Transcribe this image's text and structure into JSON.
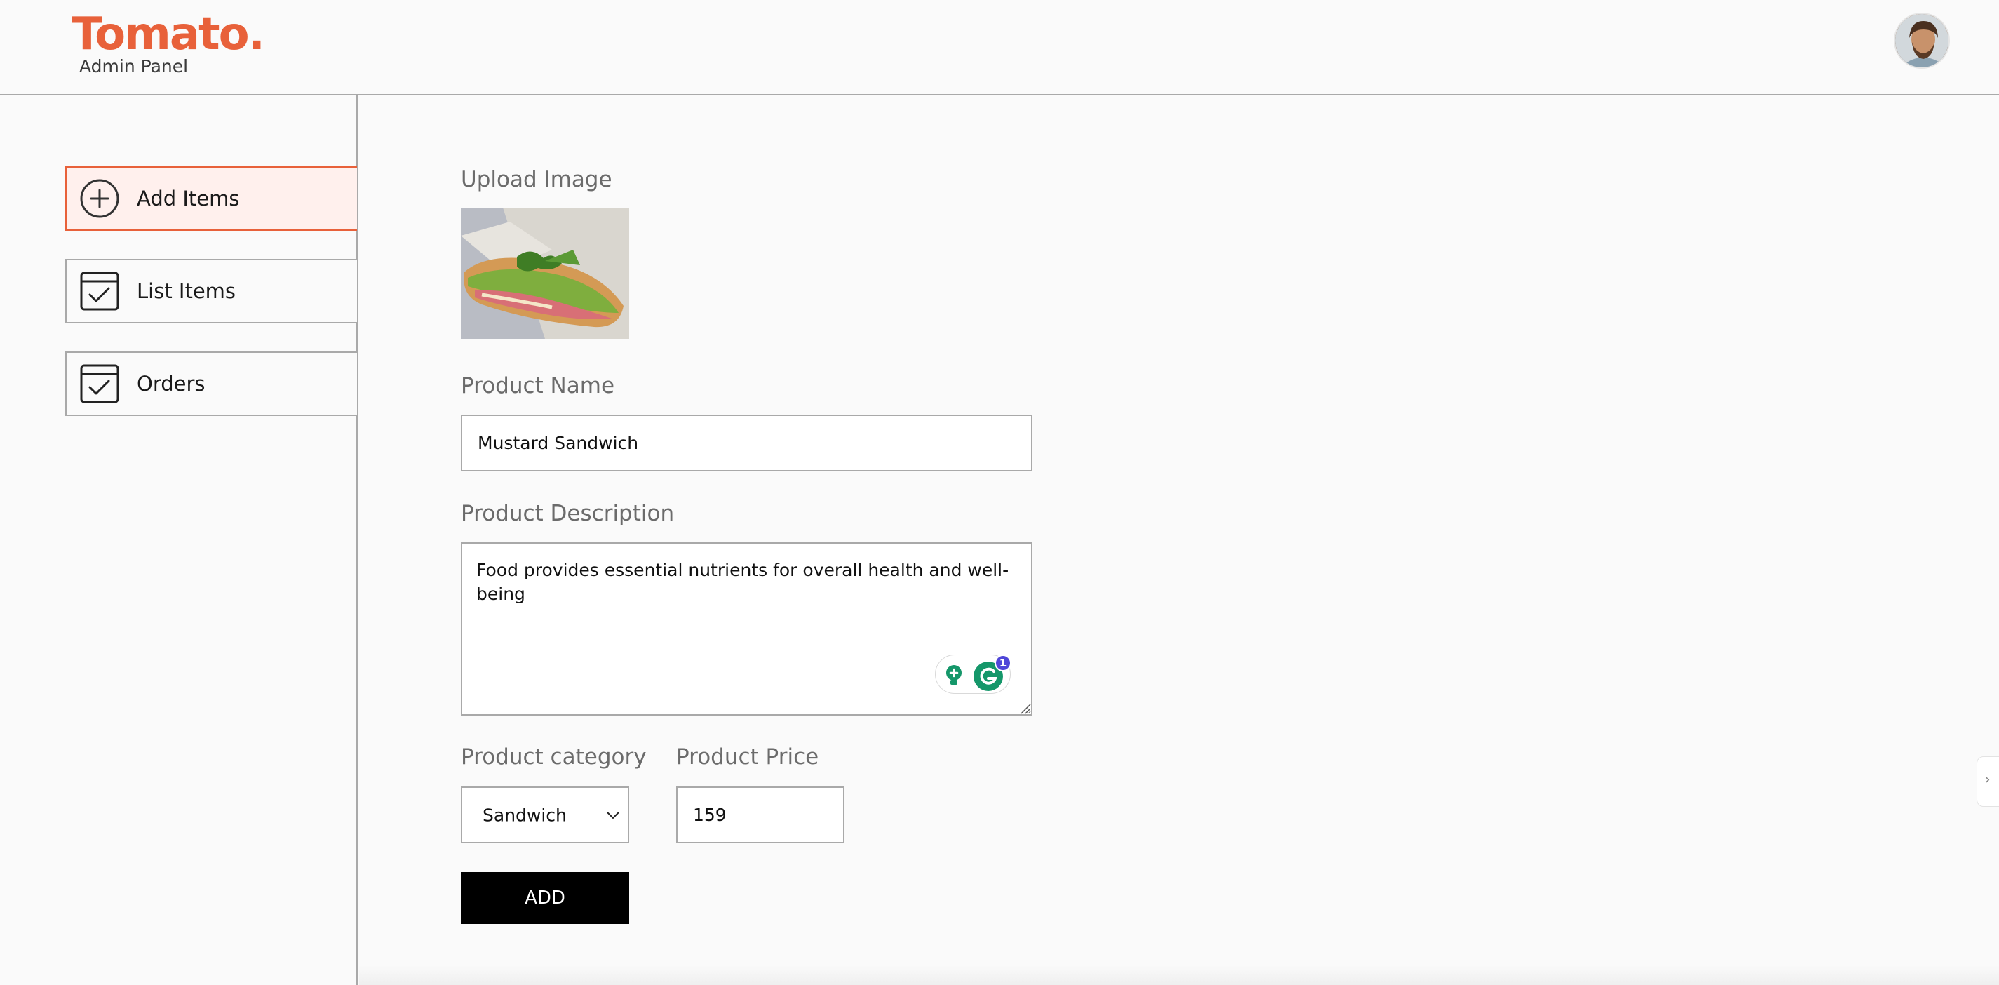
{
  "brand": {
    "logo": "Tomato.",
    "subtitle": "Admin Panel",
    "accent_color": "#e8613a"
  },
  "header": {
    "avatar_icon": "profile-avatar"
  },
  "sidebar": {
    "items": [
      {
        "label": "Add Items",
        "icon": "add-circle-icon",
        "active": true
      },
      {
        "label": "List Items",
        "icon": "checklist-icon",
        "active": false
      },
      {
        "label": "Orders",
        "icon": "checklist-icon",
        "active": false
      }
    ]
  },
  "form": {
    "upload": {
      "label": "Upload Image",
      "image_icon": "sandwich-photo"
    },
    "name": {
      "label": "Product Name",
      "value": "Mustard Sandwich"
    },
    "description": {
      "label": "Product Description",
      "value": "Food provides essential nutrients for overall health and well-being"
    },
    "category": {
      "label": "Product category",
      "selected": "Sandwich"
    },
    "price": {
      "label": "Product Price",
      "value": "159"
    },
    "submit_label": "ADD"
  },
  "grammarly": {
    "badge_count": "1",
    "colors": {
      "primary": "#15976a",
      "badge": "#4f46d8"
    }
  },
  "edge_tab": {
    "glyph": "›"
  }
}
